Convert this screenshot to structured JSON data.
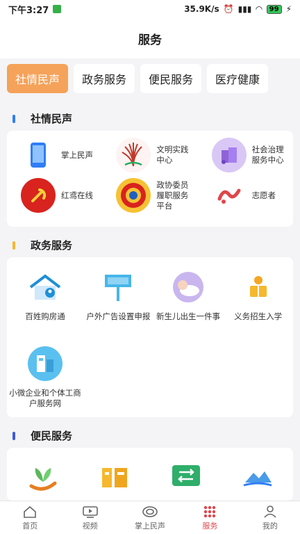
{
  "status": {
    "time": "下午3:27",
    "speed": "35.9K/s",
    "battery": "99"
  },
  "header": {
    "title": "服务"
  },
  "tabs": [
    "社情民声",
    "政务服务",
    "便民服务",
    "医疗健康"
  ],
  "sections": {
    "sqms": {
      "title": "社情民声",
      "color": "#2f7df6",
      "items": [
        {
          "label": "掌上民声",
          "icon": "phone-icon"
        },
        {
          "label": "文明实践中心",
          "icon": "civilization-icon"
        },
        {
          "label": "社会治理服务中心",
          "icon": "governance-icon"
        },
        {
          "label": "红鸢在线",
          "icon": "party-emblem-icon"
        },
        {
          "label": "政协委员履职服务平台",
          "icon": "cppcc-emblem-icon"
        },
        {
          "label": "志愿者",
          "icon": "volunteer-icon"
        }
      ]
    },
    "zwfw": {
      "title": "政务服务",
      "color": "#f5b82e",
      "items": [
        {
          "label": "百姓购房通",
          "icon": "house-icon"
        },
        {
          "label": "户外广告设置申报",
          "icon": "billboard-icon"
        },
        {
          "label": "新生儿出生一件事",
          "icon": "baby-icon"
        },
        {
          "label": "义务招生入学",
          "icon": "student-icon"
        },
        {
          "label": "小微企业和个体工商户服务网",
          "icon": "enterprise-icon"
        }
      ]
    },
    "bmfw": {
      "title": "便民服务",
      "color": "#3b5bdb"
    }
  },
  "nav": [
    {
      "label": "首页",
      "icon": "home-icon"
    },
    {
      "label": "视频",
      "icon": "video-icon"
    },
    {
      "label": "掌上民声",
      "icon": "voice-icon"
    },
    {
      "label": "服务",
      "icon": "service-grid-icon"
    },
    {
      "label": "我的",
      "icon": "user-icon"
    }
  ]
}
